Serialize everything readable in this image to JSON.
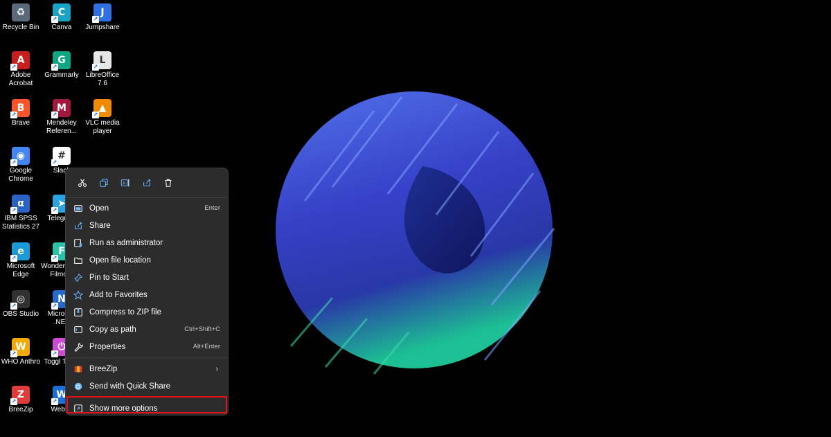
{
  "desktop": {
    "icons": [
      {
        "label": "Recycle Bin",
        "icon": "recycle-bin-icon",
        "color": "#5a6a7a"
      },
      {
        "label": "Canva",
        "icon": "canva-icon",
        "color": "#1ba3c6"
      },
      {
        "label": "Jumpshare",
        "icon": "jumpshare-icon",
        "color": "#2f6fe4"
      },
      {
        "label": "Adobe Acrobat",
        "icon": "adobe-acrobat-icon",
        "color": "#c81e1e"
      },
      {
        "label": "Grammarly",
        "icon": "grammarly-icon",
        "color": "#11a683"
      },
      {
        "label": "LibreOffice 7.6",
        "icon": "libreoffice-icon",
        "color": "#e6e6e6"
      },
      {
        "label": "Brave",
        "icon": "brave-icon",
        "color": "#fb542b"
      },
      {
        "label": "Mendeley Referen...",
        "icon": "mendeley-icon",
        "color": "#a0183a"
      },
      {
        "label": "VLC media player",
        "icon": "vlc-icon",
        "color": "#f08a00"
      },
      {
        "label": "Google Chrome",
        "icon": "chrome-icon",
        "color": "#4285f4"
      },
      {
        "label": "Slack",
        "icon": "slack-icon",
        "color": "#ffffff"
      },
      {
        "label": "IBM SPSS Statistics 27",
        "icon": "spss-icon",
        "color": "#2b63c4"
      },
      {
        "label": "Telegram",
        "icon": "telegram-icon",
        "color": "#2aa3e0"
      },
      {
        "label": "Microsoft Edge",
        "icon": "edge-icon",
        "color": "#1a9ad6"
      },
      {
        "label": "Wondershare Filmora",
        "icon": "filmora-icon",
        "color": "#2ac2a8"
      },
      {
        "label": "OBS Studio",
        "icon": "obs-icon",
        "color": "#303030"
      },
      {
        "label": "Microsoft .NET",
        "icon": "dotnet-icon",
        "color": "#2569c9"
      },
      {
        "label": "WHO Anthro",
        "icon": "who-anthro-icon",
        "color": "#f2a900"
      },
      {
        "label": "Toggl Track",
        "icon": "toggl-icon",
        "color": "#d04bd4"
      },
      {
        "label": "BreeZip",
        "icon": "breezip-icon",
        "color": "#e23b3b"
      },
      {
        "label": "Webex",
        "icon": "webex-icon",
        "color": "#1d6fd6"
      }
    ]
  },
  "context_menu": {
    "quick_actions": [
      {
        "name": "cut",
        "icon": "scissors-icon"
      },
      {
        "name": "copy",
        "icon": "copy-icon"
      },
      {
        "name": "rename",
        "icon": "rename-icon"
      },
      {
        "name": "share",
        "icon": "share-icon"
      },
      {
        "name": "delete",
        "icon": "trash-icon"
      }
    ],
    "items": [
      {
        "label": "Open",
        "shortcut": "Enter",
        "icon": "open-icon"
      },
      {
        "label": "Share",
        "shortcut": "",
        "icon": "share-icon"
      },
      {
        "label": "Run as administrator",
        "shortcut": "",
        "icon": "shield-icon"
      },
      {
        "label": "Open file location",
        "shortcut": "",
        "icon": "folder-icon"
      },
      {
        "label": "Pin to Start",
        "shortcut": "",
        "icon": "pin-icon"
      },
      {
        "label": "Add to Favorites",
        "shortcut": "",
        "icon": "star-icon"
      },
      {
        "label": "Compress to ZIP file",
        "shortcut": "",
        "icon": "zip-icon"
      },
      {
        "label": "Copy as path",
        "shortcut": "Ctrl+Shift+C",
        "icon": "path-icon"
      },
      {
        "label": "Properties",
        "shortcut": "Alt+Enter",
        "icon": "wrench-icon"
      }
    ],
    "items2": [
      {
        "label": "BreeZip",
        "icon": "breezip-icon",
        "has_submenu": true
      },
      {
        "label": "Send with Quick Share",
        "icon": "quick-share-icon",
        "has_submenu": false
      }
    ],
    "items3": [
      {
        "label": "Show more options",
        "icon": "more-options-icon"
      }
    ],
    "highlight_color": "#e0141b",
    "icon_color": "#6cb4ff"
  }
}
